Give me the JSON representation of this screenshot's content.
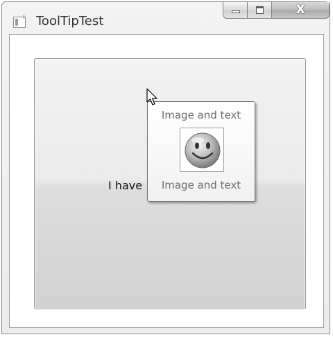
{
  "window": {
    "title": "ToolTipTest",
    "close_label": "X"
  },
  "content": {
    "button_text": "I have"
  },
  "tooltip": {
    "top_text": "Image and text",
    "image_icon": "smiley-face-icon",
    "bottom_text": "Image and text"
  },
  "colors": {
    "tooltip_text": "#6e6e6e",
    "button_text": "#111111"
  }
}
